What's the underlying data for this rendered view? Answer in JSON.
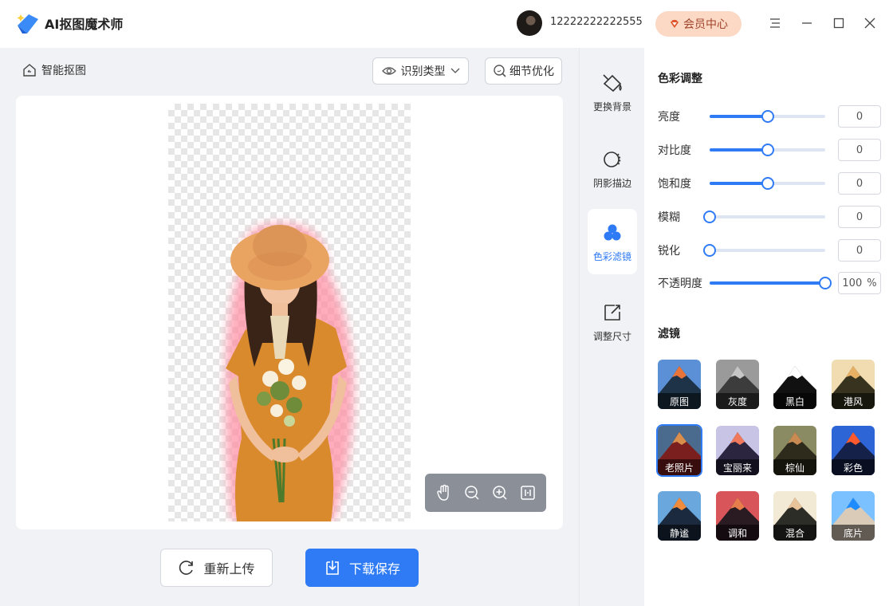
{
  "app": {
    "title": "AI抠图魔术师"
  },
  "user": {
    "name": "12222222222555",
    "vip_label": "会员中心"
  },
  "toolbar": {
    "breadcrumb": "智能抠图",
    "recognize_type": "识别类型",
    "detail_optimize": "细节优化"
  },
  "actions": {
    "reupload": "重新上传",
    "save": "下载保存"
  },
  "tabs": [
    {
      "label": "更换背景",
      "icon": "paint-bucket-icon"
    },
    {
      "label": "阴影描边",
      "icon": "shadow-outline-icon"
    },
    {
      "label": "色彩滤镜",
      "icon": "color-filter-icon",
      "active": true
    },
    {
      "label": "调整尺寸",
      "icon": "resize-icon"
    }
  ],
  "color_adjust": {
    "title": "色彩调整",
    "items": [
      {
        "label": "亮度",
        "value": "0",
        "level": 0.5
      },
      {
        "label": "对比度",
        "value": "0",
        "level": 0.5
      },
      {
        "label": "饱和度",
        "value": "0",
        "level": 0.5
      },
      {
        "label": "模糊",
        "value": "0",
        "level": 0
      },
      {
        "label": "锐化",
        "value": "0",
        "level": 0
      },
      {
        "label": "不透明度",
        "value": "100",
        "unit": "%",
        "level": 1
      }
    ]
  },
  "filters": {
    "title": "滤镜",
    "items": [
      {
        "label": "原图",
        "sky": "#5b8fd6",
        "peak": "#e8743a",
        "base": "#1e3347"
      },
      {
        "label": "灰度",
        "sky": "#9a9a9a",
        "peak": "#c6c6c6",
        "base": "#3c3c3c"
      },
      {
        "label": "黑白",
        "sky": "#ffffff",
        "peak": "#ffffff",
        "base": "#111111"
      },
      {
        "label": "港风",
        "sky": "#f1dcb2",
        "peak": "#e7b065",
        "base": "#37331f"
      },
      {
        "label": "老照片",
        "sky": "#4a6b8e",
        "peak": "#d98e4c",
        "base": "#7a1e1e",
        "selected": true
      },
      {
        "label": "宝丽来",
        "sky": "#c8c4e6",
        "peak": "#f0795b",
        "base": "#2b2540"
      },
      {
        "label": "棕仙",
        "sky": "#8b8b63",
        "peak": "#c98b52",
        "base": "#2e2a1c"
      },
      {
        "label": "彩色",
        "sky": "#2d64d6",
        "peak": "#ff5a2d",
        "base": "#16214a"
      },
      {
        "label": "静谧",
        "sky": "#6aa7dc",
        "peak": "#f08b3b",
        "base": "#1b2a3f"
      },
      {
        "label": "调和",
        "sky": "#d8555a",
        "peak": "#e87d4c",
        "base": "#2a1a22"
      },
      {
        "label": "混合",
        "sky": "#f3ead6",
        "peak": "#e9c39a",
        "base": "#2d2d28"
      },
      {
        "label": "底片",
        "sky": "#7cc1ff",
        "peak": "#1e8cff",
        "base": "#d9cbb8"
      }
    ]
  },
  "colors": {
    "accent": "#2f7bf6",
    "vip_bg": "#fcd9c4",
    "vip_text": "#a0442b"
  }
}
